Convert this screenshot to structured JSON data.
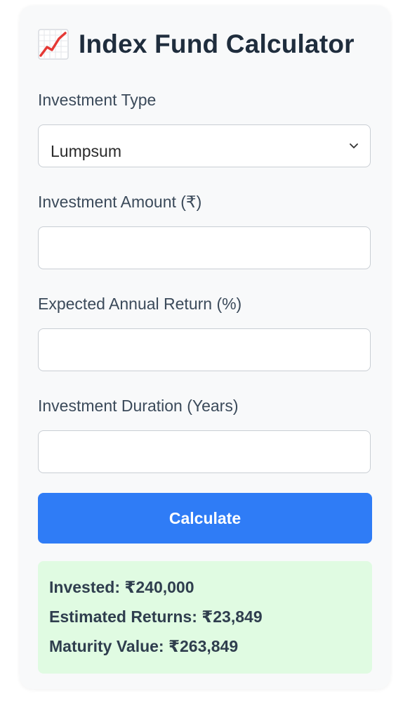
{
  "header": {
    "icon": "chart-increasing-icon",
    "title": "Index Fund Calculator"
  },
  "form": {
    "investment_type": {
      "label": "Investment Type",
      "value": "Lumpsum"
    },
    "amount": {
      "label": "Investment Amount (₹)",
      "value": ""
    },
    "annual_return": {
      "label": "Expected Annual Return (%)",
      "value": ""
    },
    "duration": {
      "label": "Investment Duration (Years)",
      "value": ""
    },
    "submit_label": "Calculate"
  },
  "result": {
    "invested": "Invested: ₹240,000",
    "estimated_returns": "Estimated Returns: ₹23,849",
    "maturity_value": "Maturity Value: ₹263,849"
  },
  "colors": {
    "primary": "#2f7cf6",
    "result_background": "#e0fbe2",
    "title": "#1f2d3d",
    "card_background": "#f8f9fa"
  }
}
